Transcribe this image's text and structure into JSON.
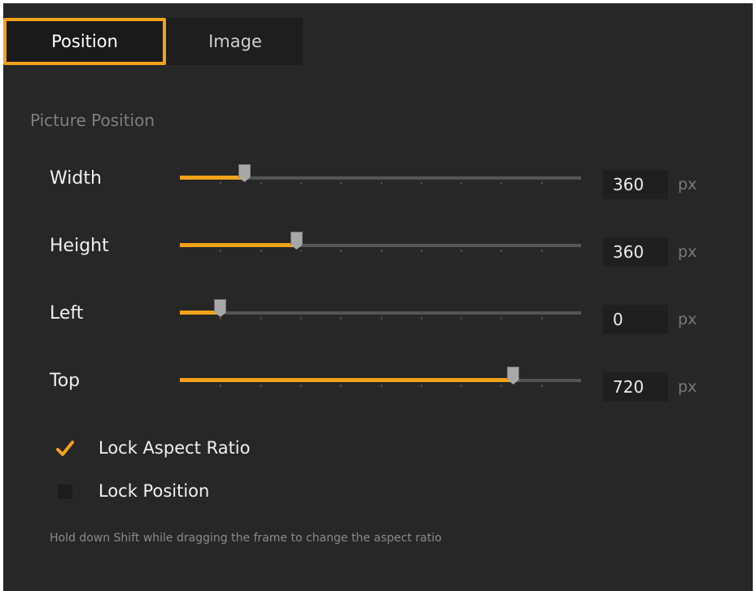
{
  "tabs": [
    {
      "label": "Position",
      "active": true
    },
    {
      "label": "Image",
      "active": false
    }
  ],
  "section_title": "Picture Position",
  "rows": [
    {
      "label": "Width",
      "value": "360",
      "unit": "px",
      "slider_fraction": 0.16
    },
    {
      "label": "Height",
      "value": "360",
      "unit": "px",
      "slider_fraction": 0.29
    },
    {
      "label": "Left",
      "value": "0",
      "unit": "px",
      "slider_fraction": 0.1
    },
    {
      "label": "Top",
      "value": "720",
      "unit": "px",
      "slider_fraction": 0.83
    }
  ],
  "checkboxes": [
    {
      "label": "Lock Aspect Ratio",
      "checked": true
    },
    {
      "label": "Lock Position",
      "checked": false
    }
  ],
  "hint": "Hold down Shift while dragging the frame to change the aspect ratio",
  "colors": {
    "accent": "#f3a21c",
    "panel_bg": "#272727",
    "tabbar_bg": "#1e1e1e"
  }
}
